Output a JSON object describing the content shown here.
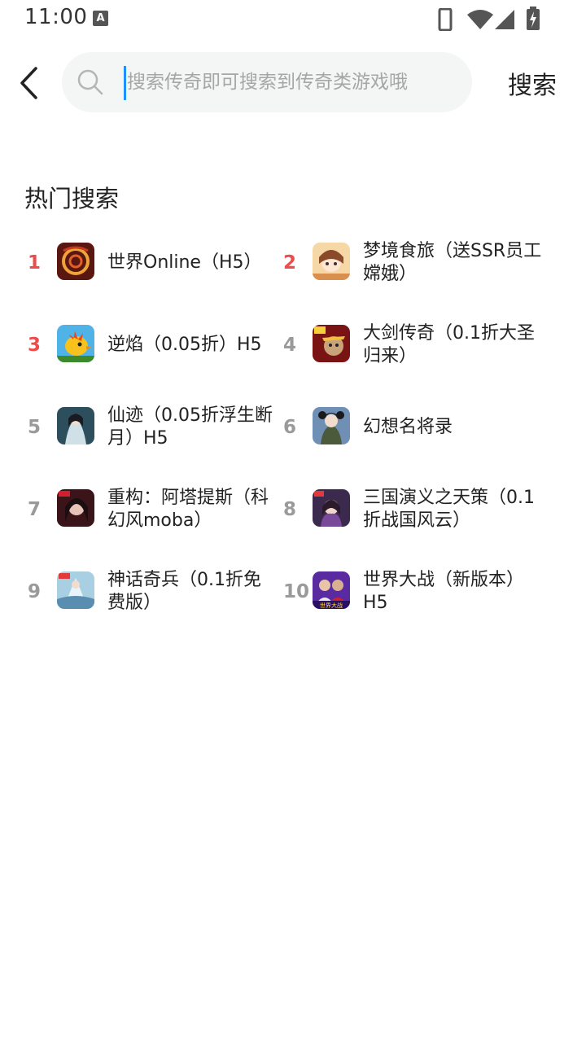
{
  "status": {
    "time": "11:00",
    "a_label": "A"
  },
  "search": {
    "placeholder": "搜索传奇即可搜索到传奇类游戏哦",
    "value": "",
    "button_label": "搜索"
  },
  "hot": {
    "title": "热门搜索",
    "items": [
      {
        "rank": "1",
        "name": "世界Online（H5）",
        "highlight": true,
        "icon": "dragon-ring-game-icon"
      },
      {
        "rank": "2",
        "name": "梦境食旅（送SSR员工嫦娥）",
        "highlight": true,
        "icon": "anime-girl-game-icon"
      },
      {
        "rank": "3",
        "name": "逆焰（0.05折）H5",
        "highlight": true,
        "icon": "yellow-bird-game-icon"
      },
      {
        "rank": "4",
        "name": "大剑传奇（0.1折大圣归来）",
        "highlight": false,
        "icon": "monkey-king-game-icon"
      },
      {
        "rank": "5",
        "name": "仙迹（0.05折浮生断月）H5",
        "highlight": false,
        "icon": "fairy-game-icon"
      },
      {
        "rank": "6",
        "name": "幻想名将录",
        "highlight": false,
        "icon": "general-game-icon"
      },
      {
        "rank": "7",
        "name": "重构：阿塔提斯（科幻风moba）",
        "highlight": false,
        "icon": "dark-hero-game-icon"
      },
      {
        "rank": "8",
        "name": "三国演义之天策（0.1折战国风云）",
        "highlight": false,
        "icon": "three-kingdoms-game-icon"
      },
      {
        "rank": "9",
        "name": "神话奇兵（0.1折免费版）",
        "highlight": false,
        "icon": "ice-warrior-game-icon"
      },
      {
        "rank": "10",
        "name": "世界大战（新版本）H5",
        "highlight": false,
        "icon": "soccer-game-icon",
        "icon_text": "世界大战"
      }
    ]
  },
  "colors": {
    "rank_highlight": "#ee4b4b",
    "rank_normal": "#9a9a9a",
    "caret": "#1e90ff",
    "search_bg": "#f4f5f5"
  }
}
